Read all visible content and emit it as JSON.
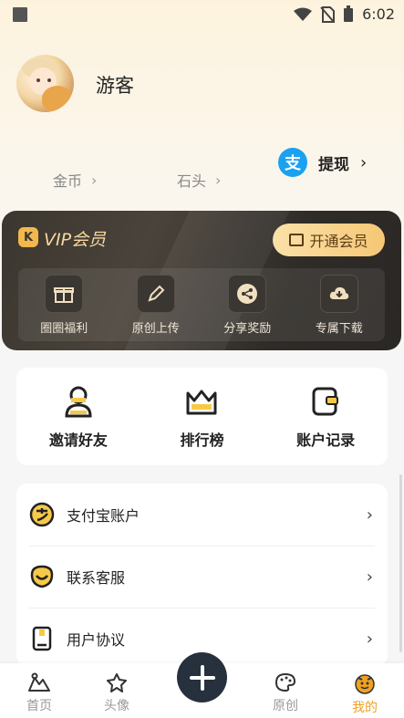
{
  "status_bar": {
    "time": "6:02"
  },
  "profile": {
    "name": "游客"
  },
  "stats": {
    "coins_label": "金币",
    "stones_label": "石头"
  },
  "withdraw": {
    "badge": "支",
    "label": "提现"
  },
  "vip": {
    "logo": "K",
    "title": "VIP会员",
    "open_button": "开通会员",
    "items": [
      {
        "label": "圈圈福利",
        "icon": "gift-icon"
      },
      {
        "label": "原创上传",
        "icon": "pen-icon"
      },
      {
        "label": "分享奖励",
        "icon": "share-icon"
      },
      {
        "label": "专属下载",
        "icon": "download-icon"
      }
    ]
  },
  "quick": [
    {
      "label": "邀请好友",
      "icon": "invite-user-icon"
    },
    {
      "label": "排行榜",
      "icon": "crown-icon"
    },
    {
      "label": "账户记录",
      "icon": "wallet-icon"
    }
  ],
  "list": [
    {
      "label": "支付宝账户",
      "icon": "alipay-icon"
    },
    {
      "label": "联系客服",
      "icon": "service-icon"
    },
    {
      "label": "用户协议",
      "icon": "document-icon"
    }
  ],
  "nav": [
    {
      "label": "首页",
      "icon": "home-icon"
    },
    {
      "label": "头像",
      "icon": "star-icon"
    },
    {
      "label": "原创",
      "icon": "palette-icon"
    },
    {
      "label": "我的",
      "icon": "profile-face-icon"
    }
  ],
  "colors": {
    "accent": "#f0a123",
    "vip_gold": "#f6c775",
    "fab": "#26313d",
    "alipay": "#1aa1f0"
  }
}
